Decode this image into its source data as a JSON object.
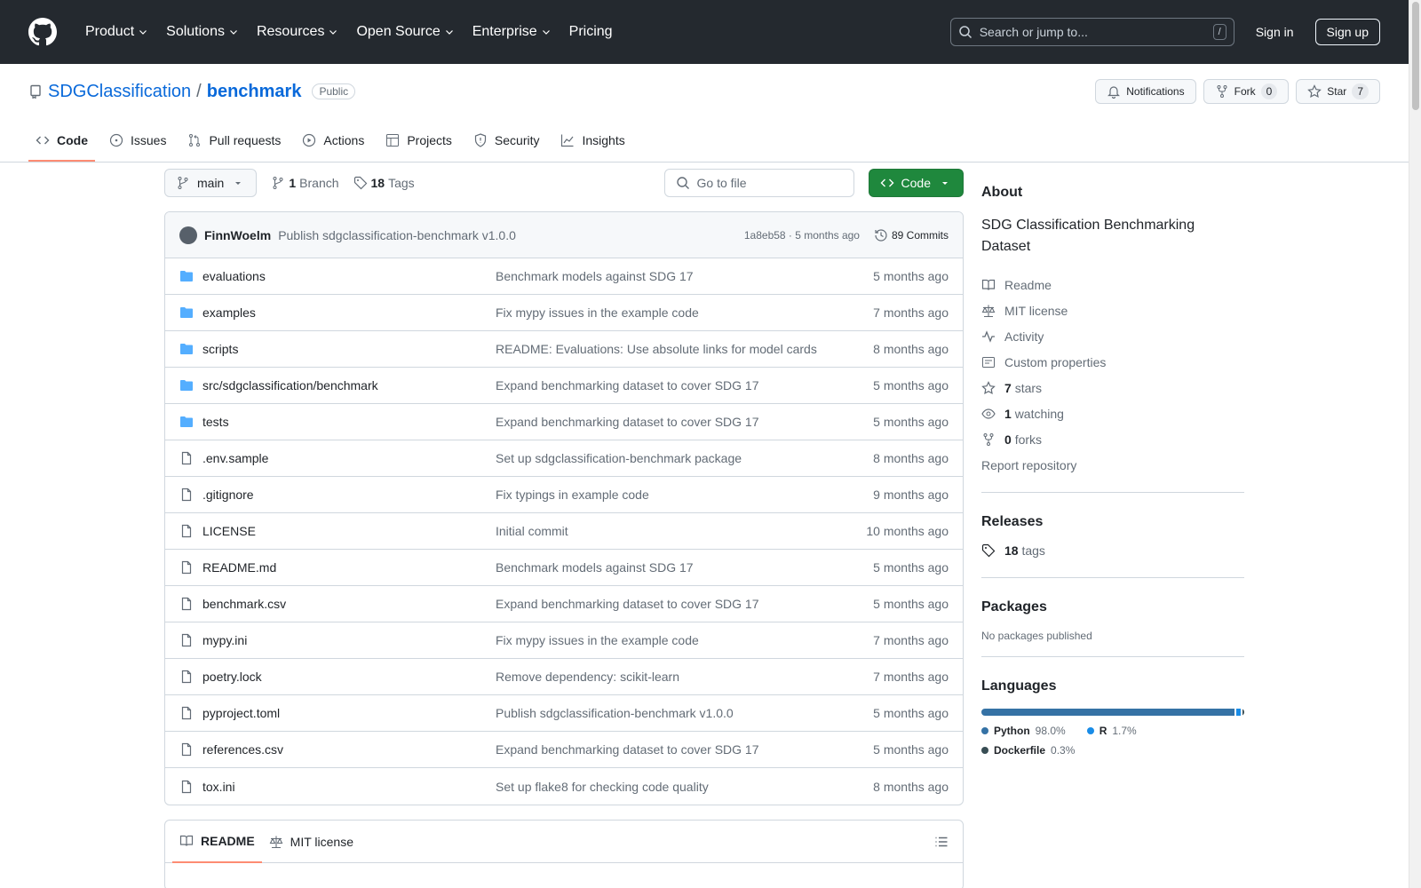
{
  "header": {
    "nav": [
      "Product",
      "Solutions",
      "Resources",
      "Open Source",
      "Enterprise",
      "Pricing"
    ],
    "search_placeholder": "Search or jump to...",
    "search_shortcut": "/",
    "signin": "Sign in",
    "signup": "Sign up"
  },
  "repo": {
    "owner": "SDGClassification",
    "separator": "/",
    "name": "benchmark",
    "visibility": "Public",
    "notifications_label": "Notifications",
    "fork_label": "Fork",
    "fork_count": "0",
    "star_label": "Star",
    "star_count": "7"
  },
  "tabs": [
    "Code",
    "Issues",
    "Pull requests",
    "Actions",
    "Projects",
    "Security",
    "Insights"
  ],
  "toolbar": {
    "branch": "main",
    "branch_count": "1",
    "branch_label": "Branch",
    "tag_count": "18",
    "tag_label": "Tags",
    "goto_placeholder": "Go to file",
    "code_button": "Code"
  },
  "latest_commit": {
    "author": "FinnWoelm",
    "message": "Publish sdgclassification-benchmark v1.0.0",
    "hash_time": "1a8eb58 · 5 months ago",
    "commits": "89 Commits"
  },
  "files": [
    {
      "name": "evaluations",
      "type": "dir",
      "message": "Benchmark models against SDG 17",
      "date": "5 months ago"
    },
    {
      "name": "examples",
      "type": "dir",
      "message": "Fix mypy issues in the example code",
      "date": "7 months ago"
    },
    {
      "name": "scripts",
      "type": "dir",
      "message": "README: Evaluations: Use absolute links for model cards",
      "date": "8 months ago"
    },
    {
      "name": "src/sdgclassification/benchmark",
      "type": "dir",
      "message": "Expand benchmarking dataset to cover SDG 17",
      "date": "5 months ago"
    },
    {
      "name": "tests",
      "type": "dir",
      "message": "Expand benchmarking dataset to cover SDG 17",
      "date": "5 months ago"
    },
    {
      "name": ".env.sample",
      "type": "file",
      "message": "Set up sdgclassification-benchmark package",
      "date": "8 months ago"
    },
    {
      "name": ".gitignore",
      "type": "file",
      "message": "Fix typings in example code",
      "date": "9 months ago"
    },
    {
      "name": "LICENSE",
      "type": "file",
      "message": "Initial commit",
      "date": "10 months ago"
    },
    {
      "name": "README.md",
      "type": "file",
      "message": "Benchmark models against SDG 17",
      "date": "5 months ago"
    },
    {
      "name": "benchmark.csv",
      "type": "file",
      "message": "Expand benchmarking dataset to cover SDG 17",
      "date": "5 months ago"
    },
    {
      "name": "mypy.ini",
      "type": "file",
      "message": "Fix mypy issues in the example code",
      "date": "7 months ago"
    },
    {
      "name": "poetry.lock",
      "type": "file",
      "message": "Remove dependency: scikit-learn",
      "date": "7 months ago"
    },
    {
      "name": "pyproject.toml",
      "type": "file",
      "message": "Publish sdgclassification-benchmark v1.0.0",
      "date": "5 months ago"
    },
    {
      "name": "references.csv",
      "type": "file",
      "message": "Expand benchmarking dataset to cover SDG 17",
      "date": "5 months ago"
    },
    {
      "name": "tox.ini",
      "type": "file",
      "message": "Set up flake8 for checking code quality",
      "date": "8 months ago"
    }
  ],
  "readme_tabs": [
    "README",
    "MIT license"
  ],
  "about": {
    "title": "About",
    "description": "SDG Classification Benchmarking Dataset",
    "links": [
      {
        "icon": "book-icon",
        "bold": "",
        "text": "Readme"
      },
      {
        "icon": "scale-icon",
        "bold": "",
        "text": "MIT license"
      },
      {
        "icon": "pulse-icon",
        "bold": "",
        "text": "Activity"
      },
      {
        "icon": "note-icon",
        "bold": "",
        "text": "Custom properties"
      },
      {
        "icon": "star-icon",
        "bold": "7",
        "text": "stars"
      },
      {
        "icon": "eye-icon",
        "bold": "1",
        "text": "watching"
      },
      {
        "icon": "fork-icon",
        "bold": "0",
        "text": "forks"
      }
    ],
    "report": "Report repository"
  },
  "releases": {
    "title": "Releases",
    "tag_count": "18",
    "tag_label": "tags"
  },
  "packages": {
    "title": "Packages",
    "text": "No packages published"
  },
  "languages": {
    "title": "Languages",
    "items": [
      {
        "name": "Python",
        "pct": "98.0%",
        "value": 98.0,
        "color": "#3572A5"
      },
      {
        "name": "R",
        "pct": "1.7%",
        "value": 1.7,
        "color": "#198CE7"
      },
      {
        "name": "Dockerfile",
        "pct": "0.3%",
        "value": 0.3,
        "color": "#384d54"
      }
    ]
  }
}
